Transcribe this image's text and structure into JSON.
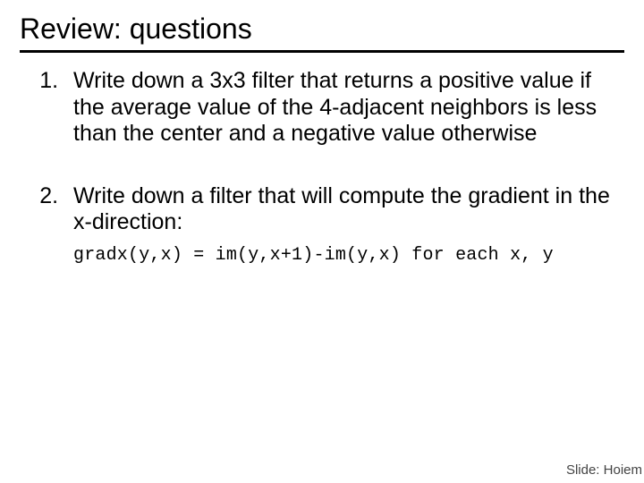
{
  "title": "Review: questions",
  "questions": [
    {
      "text": "Write down a 3x3 filter that returns a positive value if the average value of the 4-adjacent neighbors is less than the center and a negative value otherwise"
    },
    {
      "text": "Write down a filter that will compute the gradient in the x-direction:",
      "code": "gradx(y,x) = im(y,x+1)-im(y,x) for each x, y"
    }
  ],
  "credit": "Slide: Hoiem"
}
